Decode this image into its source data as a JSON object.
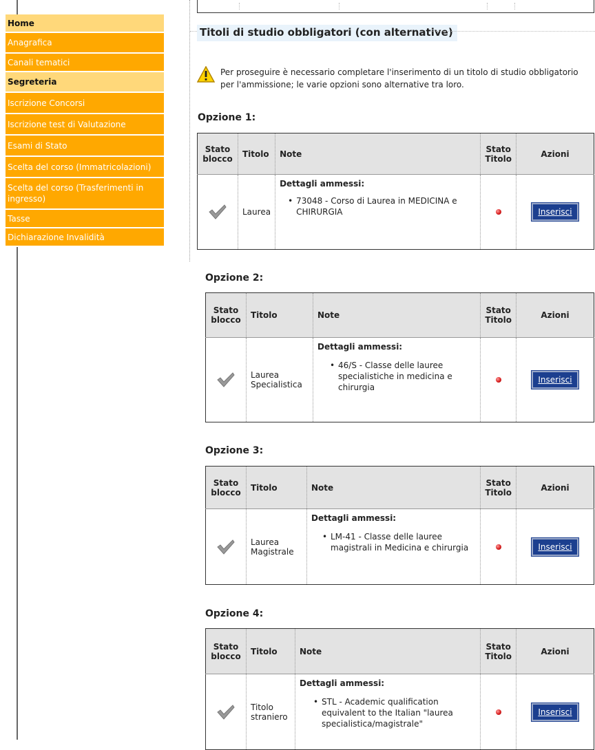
{
  "sidebar": {
    "items": [
      {
        "label": "Home",
        "type": "section"
      },
      {
        "label": "Anagrafica",
        "type": "link"
      },
      {
        "label": "Canali tematici",
        "type": "link"
      },
      {
        "label": "Segreteria",
        "type": "section"
      },
      {
        "label": "Iscrizione Concorsi",
        "type": "link"
      },
      {
        "label": "Iscrizione test di Valutazione",
        "type": "link"
      },
      {
        "label": "Esami di Stato",
        "type": "link"
      },
      {
        "label": "Scelta del corso (Immatricolazioni)",
        "type": "link"
      },
      {
        "label": "Scelta del corso (Trasferimenti in ingresso)",
        "type": "link"
      },
      {
        "label": "Tasse",
        "type": "link"
      },
      {
        "label": "Dichiarazione Invalidità",
        "type": "link"
      }
    ]
  },
  "main": {
    "fieldset_title": "Titoli di studio obbligatori (con alternative)",
    "warning": "Per proseguire è necessario completare l'inserimento di un titolo di studio obbligatorio per l'ammissione; le varie opzioni sono alternative tra loro.",
    "table_headers": {
      "stato_blocco": "Stato blocco",
      "titolo": "Titolo",
      "note": "Note",
      "stato_titolo": "Stato Titolo",
      "azioni": "Azioni"
    },
    "options": [
      {
        "title": "Opzione 1:",
        "titolo": "Laurea",
        "note_head": "Dettagli ammessi:",
        "detail": "73048 - Corso di Laurea in MEDICINA e CHIRURGIA",
        "button": "Inserisci"
      },
      {
        "title": "Opzione 2:",
        "titolo": "Laurea Specialistica",
        "note_head": "Dettagli ammessi:",
        "detail": "46/S - Classe delle lauree specialistiche in medicina e chirurgia",
        "button": "Inserisci"
      },
      {
        "title": "Opzione 3:",
        "titolo": "Laurea Magistrale",
        "note_head": "Dettagli ammessi:",
        "detail": "LM-41 - Classe delle lauree magistrali in Medicina e chirurgia",
        "button": "Inserisci"
      },
      {
        "title": "Opzione 4:",
        "titolo": "Titolo straniero",
        "note_head": "Dettagli ammessi:",
        "detail": "STL - Academic qualification equivalent to the Italian \"laurea specialistica/magistrale\"",
        "button": "Inserisci"
      }
    ]
  },
  "colors": {
    "sidebar_link": "#ffa800",
    "sidebar_section": "#ffd87a",
    "button": "#1c3f8f",
    "status_red": "#d51a1a"
  }
}
